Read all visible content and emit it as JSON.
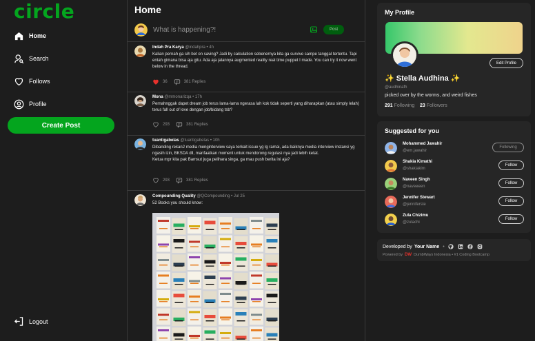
{
  "app": {
    "logo": "circle"
  },
  "nav": {
    "items": [
      {
        "label": "Home",
        "icon": "home-icon"
      },
      {
        "label": "Search",
        "icon": "search-icon"
      },
      {
        "label": "Follows",
        "icon": "heart-icon"
      },
      {
        "label": "Profile",
        "icon": "user-circle-icon"
      }
    ],
    "create_post": "Create Post",
    "logout": "Logout"
  },
  "feed": {
    "title": "Home",
    "composer_placeholder": "What is happening?!",
    "post_button": "Post",
    "threads": [
      {
        "name": "Indah Pra Karya",
        "handle": "@indahpra",
        "time": "4h",
        "text": "Kalian pernah ga sih bet on saving? Jadi by calculation sebenernya kita ga survive sampe tanggal tertentu. Tapi entah gimana bisa aja gitu. Ada aja jalannya augmented reality real time puppet I made. You can try it now went below in the thread.",
        "likes": "36",
        "replies": "381 Replies",
        "liked": true
      },
      {
        "name": "Mona",
        "handle": "@mmonarizqa",
        "time": "17h",
        "text": "Pernahnggak dapet dream job terus lama-lama ngerasa lah kok tidak seperti yang diharapkan (atau simply lelah) terus fall out of love dengan job/bidang tsb?",
        "likes": "293",
        "replies": "381 Replies",
        "liked": false
      },
      {
        "name": "tuantigabelas",
        "handle": "@tuantigabelas",
        "time": "10h",
        "text": "Dibanding rekan2 media menginterview saya terkait issue yg lg ramai, ada baiknya media interview instansi yg ngasih izin, BKSDA dll, manfaatkan moment untuk mendorong regulasi nya jadi lebih ketat.",
        "text2": "Ketua mpr kita pak Bamsut juga pelihara singa, ga mau push berita ini aja?",
        "likes": "293",
        "replies": "381 Replies",
        "liked": false
      },
      {
        "name": "Compounding Quality",
        "handle": "@QCompounding",
        "time": "Jul 25",
        "text": "52 Books you should know:"
      }
    ]
  },
  "profile": {
    "title": "My Profile",
    "edit_button": "Edit Profile",
    "name": "✨ Stella Audhina ✨",
    "handle": "@audhinafh",
    "bio": "picked over by the worms, and weird fishes",
    "following_count": "291",
    "following_label": "Following",
    "followers_count": "23",
    "followers_label": "Followers"
  },
  "suggestions": {
    "title": "Suggested for you",
    "users": [
      {
        "name": "Mohammed Jawahir",
        "handle": "@em.jawahir",
        "button": "Following",
        "following": true
      },
      {
        "name": "Shakia Kimathi",
        "handle": "@shakiakim",
        "button": "Follow",
        "following": false
      },
      {
        "name": "Naveen Singh",
        "handle": "@naveeeen",
        "button": "Follow",
        "following": false
      },
      {
        "name": "Jennifer Stewart",
        "handle": "@jenniferste",
        "button": "Follow",
        "following": false
      },
      {
        "name": "Zula Chizimu",
        "handle": "@zulachi",
        "button": "Follow",
        "following": false
      }
    ]
  },
  "footer": {
    "developed_by": "Developed by",
    "your_name": "Your Name",
    "powered_by": "Powered by",
    "company": "DumbWays Indonesia",
    "tagline": "#1 Coding Bootcamp",
    "logo_text": "DW"
  },
  "colors": {
    "brand": "#04a51e",
    "background": "#1d1d1d",
    "panel": "#262626",
    "like": "#e8312c",
    "muted": "#909090"
  }
}
